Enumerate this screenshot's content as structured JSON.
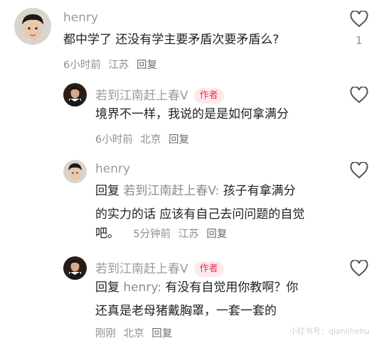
{
  "comments": [
    {
      "user": "henry",
      "text": "都中学了 还没有学主要矛盾次要矛盾么?",
      "time": "6小时前",
      "location": "江苏",
      "reply_label": "回复",
      "like_count": "1"
    },
    {
      "user": "若到江南赶上春V",
      "badge": "作者",
      "text": "境界不一样，我说的是是如何拿满分",
      "time": "6小时前",
      "location": "北京",
      "reply_label": "回复"
    },
    {
      "user": "henry",
      "reply_prefix": "回复",
      "reply_to": "若到江南赶上春V:",
      "text_line1": "孩子有拿满分",
      "text_line2": "的实力的话 应该有自己去问问题的自觉",
      "text_line3": "吧。",
      "time": "5分钟前",
      "location": "江苏",
      "reply_label": "回复"
    },
    {
      "user": "若到江南赶上春V",
      "badge": "作者",
      "reply_prefix": "回复",
      "reply_to": "henry:",
      "text_line1": "有没有自觉用你教啊？你",
      "text_line2": "还真是老母猪戴胸罩，一套一套的",
      "time": "刚刚",
      "location": "北京",
      "reply_label": "回复"
    }
  ],
  "watermark": "小红书号：qianlihehu",
  "colors": {
    "badge_bg": "#fde9ec",
    "badge_text": "#e8334a",
    "meta": "#8f8f8f"
  }
}
